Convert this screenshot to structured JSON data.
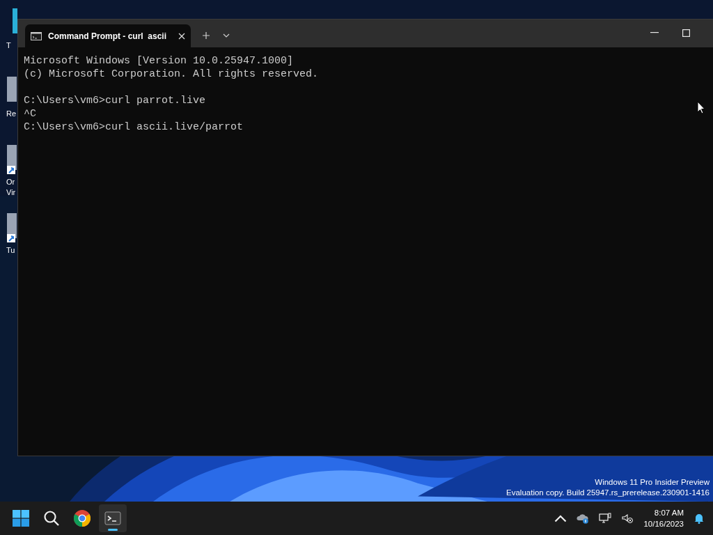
{
  "desktop": {
    "icons": [
      {
        "lines": [
          "T"
        ]
      },
      {
        "lines": [
          "Re"
        ]
      },
      {
        "lines": [
          "Or",
          "Vir"
        ]
      },
      {
        "lines": [
          "Tu"
        ]
      }
    ]
  },
  "window": {
    "tabs": [
      {
        "title": "Command Prompt - curl  ascii",
        "selected": true
      }
    ],
    "terminal": [
      [
        "Microsoft Windows [Version 10.0.25947.1000]",
        "(c) Microsoft Corporation. All rights reserved."
      ],
      [
        "C:\\Users\\vm6>curl parrot.live",
        "^C",
        "C:\\Users\\vm6>curl ascii.live/parrot"
      ]
    ]
  },
  "watermark": [
    "Windows 11 Pro Insider Preview",
    "Evaluation copy. Build 25947.rs_prerelease.230901-1416"
  ],
  "taskbar": {
    "apps": [
      {
        "kind": "start",
        "selected": false
      },
      {
        "kind": "search",
        "selected": false
      },
      {
        "kind": "browser",
        "selected": false
      },
      {
        "kind": "terminal",
        "selected": true
      }
    ],
    "time": "8:07 AM",
    "date": "10/16/2023"
  }
}
